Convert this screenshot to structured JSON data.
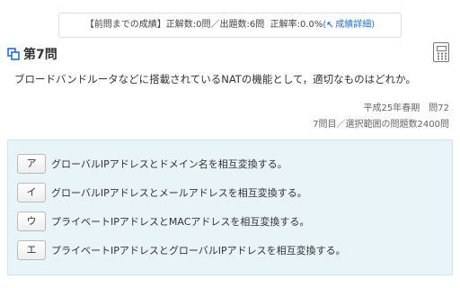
{
  "stats": {
    "label": "【前問までの成績】",
    "correct": "正解数:0問",
    "separator": "／",
    "total": "出題数:6問",
    "rate": "正解率:0.0%",
    "detail_open": "(",
    "detail_link": "成績詳細",
    "detail_close": ")"
  },
  "question": {
    "number": "第7問",
    "text": "ブロードバンドルータなどに搭載されているNATの機能として，適切なものはどれか。",
    "exam": "平成25年春期",
    "exam_number": "問72",
    "progress": "7問目／選択範囲の問題数2400問"
  },
  "choices": [
    {
      "key": "ア",
      "text": "グローバルIPアドレスとドメイン名を相互変換する。"
    },
    {
      "key": "イ",
      "text": "グローバルIPアドレスとメールアドレスを相互変換する。"
    },
    {
      "key": "ウ",
      "text": "プライベートIPアドレスとMACアドレスを相互変換する。"
    },
    {
      "key": "エ",
      "text": "プライベートIPアドレスとグローバルIPアドレスを相互変換する。"
    }
  ],
  "icons": {
    "question_icon": "copy-squares-icon",
    "calculator_icon": "calculator-icon",
    "link_icon": "external-link-icon"
  },
  "colors": {
    "link": "#2a6fc9",
    "choice_panel": "#e8f4f8"
  }
}
